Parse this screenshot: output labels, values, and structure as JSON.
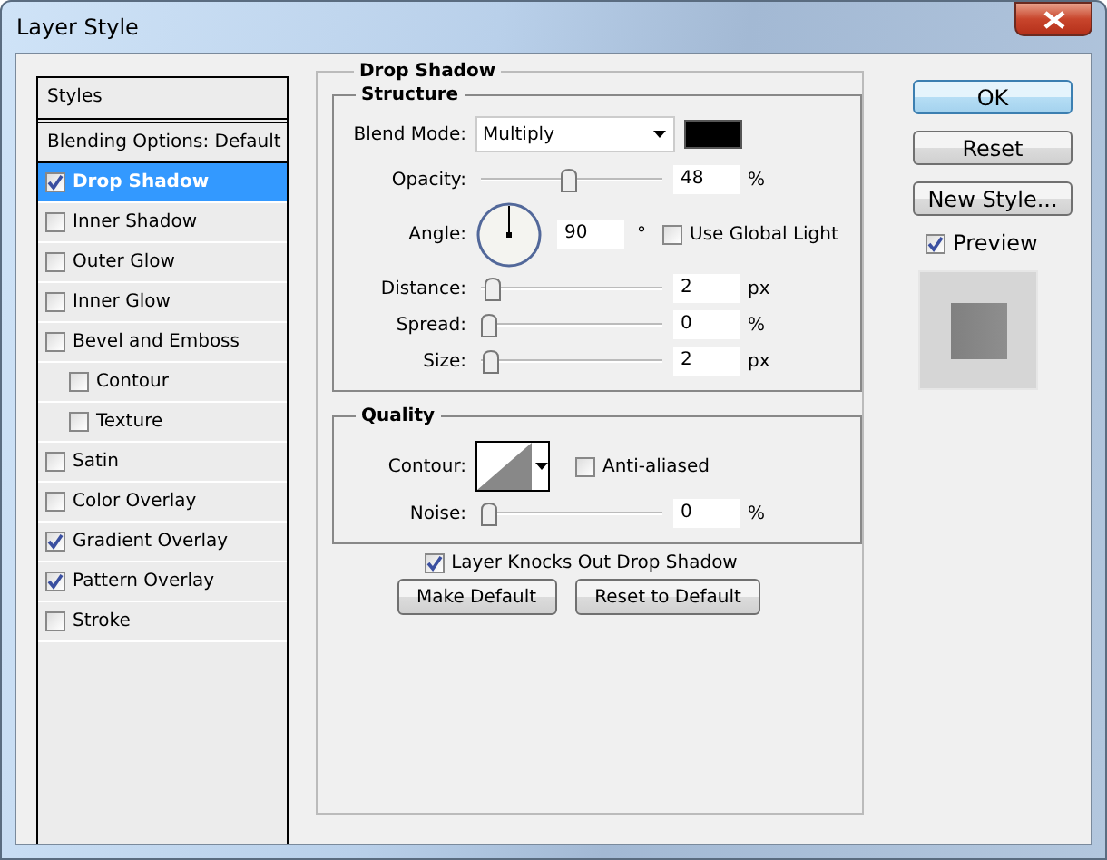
{
  "window": {
    "title": "Layer Style"
  },
  "styles_panel": {
    "header": "Styles",
    "blending_options": {
      "label": "Blending Options: Default",
      "selected": false
    },
    "items": [
      {
        "label": "Drop Shadow",
        "checked": true,
        "selected": true
      },
      {
        "label": "Inner Shadow",
        "checked": false,
        "selected": false
      },
      {
        "label": "Outer Glow",
        "checked": false,
        "selected": false
      },
      {
        "label": "Inner Glow",
        "checked": false,
        "selected": false
      },
      {
        "label": "Bevel and Emboss",
        "checked": false,
        "selected": false,
        "children": [
          {
            "label": "Contour",
            "checked": false,
            "selected": false
          },
          {
            "label": "Texture",
            "checked": false,
            "selected": false
          }
        ]
      },
      {
        "label": "Satin",
        "checked": false,
        "selected": false
      },
      {
        "label": "Color Overlay",
        "checked": false,
        "selected": false
      },
      {
        "label": "Gradient Overlay",
        "checked": true,
        "selected": false
      },
      {
        "label": "Pattern Overlay",
        "checked": true,
        "selected": false
      },
      {
        "label": "Stroke",
        "checked": false,
        "selected": false
      }
    ]
  },
  "drop_shadow": {
    "title": "Drop Shadow",
    "structure": {
      "title": "Structure",
      "blend_mode": {
        "label": "Blend Mode:",
        "value": "Multiply"
      },
      "rows": [
        {
          "kind": "slider",
          "label": "Opacity:",
          "level": 0.48,
          "value": "48",
          "unit": "%"
        },
        {
          "kind": "angle",
          "label": "Angle:",
          "value": "90",
          "unit": "°",
          "global_light": {
            "label": "Use Global Light",
            "checked": false
          }
        },
        {
          "kind": "slider",
          "label": "Distance:",
          "level": 0.02,
          "value": "2",
          "unit": "px"
        },
        {
          "kind": "slider",
          "label": "Spread:",
          "level": 0,
          "value": "0",
          "unit": "%"
        },
        {
          "kind": "slider",
          "label": "Size:",
          "level": 0.01,
          "value": "2",
          "unit": "px"
        }
      ]
    },
    "quality": {
      "title": "Quality",
      "contour_label": "Contour:",
      "anti_aliased": {
        "label": "Anti-aliased",
        "checked": false
      },
      "noise": {
        "label": "Noise:",
        "level": 0,
        "value": "0",
        "unit": "%"
      }
    },
    "knockout": {
      "label": "Layer Knocks Out Drop Shadow",
      "checked": true
    },
    "buttons": [
      "Make Default",
      "Reset to Default"
    ]
  },
  "actions": [
    {
      "label": "OK",
      "kind": "default"
    },
    {
      "label": "Reset",
      "kind": "normal"
    },
    {
      "label": "New Style...",
      "kind": "normal"
    }
  ],
  "preview": {
    "label": "Preview",
    "checked": true
  }
}
